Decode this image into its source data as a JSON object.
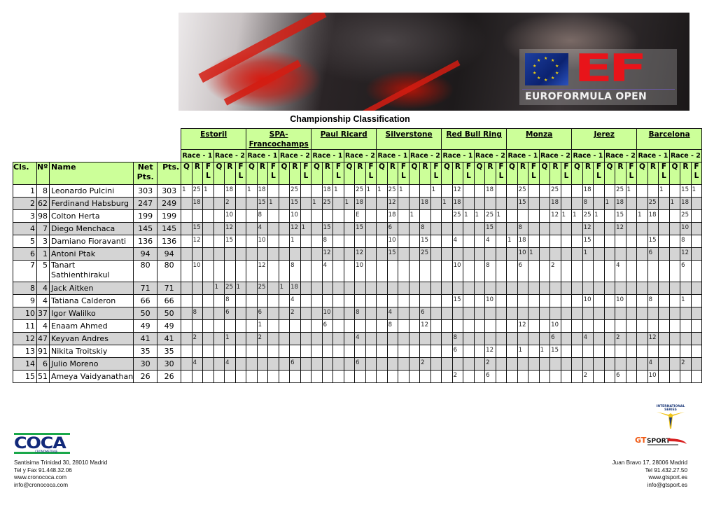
{
  "banner": {
    "logo_text": "EF",
    "logo_subtitle": "EUROFORMULA OPEN"
  },
  "title": "Championship Classification",
  "table": {
    "circuits": [
      "Estoril",
      "SPA-Francochamps",
      "Paul Ricard",
      "Silverstone",
      "Red Bull Ring",
      "Monza",
      "Jerez",
      "Barcelona"
    ],
    "races": [
      "Race - 1",
      "Race - 2"
    ],
    "sub_columns": [
      "Q",
      "R",
      "FL"
    ],
    "headers": {
      "cls": "Cls.",
      "num": "Nº",
      "name": "Name",
      "net": "Net Pts.",
      "pts": "Pts."
    },
    "rows": [
      {
        "cls": "1",
        "num": "8",
        "name": "Leonardo Pulcini",
        "net": "303",
        "pts": "303",
        "cells": [
          "1",
          "25",
          "1",
          "",
          "18",
          "",
          "1",
          "18",
          "",
          "",
          "25",
          "",
          "",
          "18",
          "1",
          "",
          "25",
          "1",
          "1",
          "25",
          "1",
          "",
          "",
          "1",
          "",
          "12",
          "",
          "",
          "18",
          "",
          "",
          "25",
          "",
          "",
          "25",
          "",
          "",
          "18",
          "",
          "",
          "25",
          "1",
          "",
          "",
          "1",
          "",
          "15",
          "1"
        ]
      },
      {
        "cls": "2",
        "num": "62",
        "name": "Ferdinand Habsburg",
        "net": "247",
        "pts": "249",
        "cells": [
          "",
          "18",
          "",
          "",
          "2",
          "",
          "",
          "15",
          "1",
          "",
          "15",
          "",
          "1",
          "25",
          "",
          "1",
          "18",
          "",
          "",
          "12",
          "",
          "",
          "18",
          "",
          "1",
          "18",
          "",
          "",
          "",
          "",
          "",
          "15",
          "",
          "",
          "18",
          "",
          "",
          "8",
          "",
          "1",
          "18",
          "",
          "",
          "25",
          "",
          "1",
          "18",
          ""
        ]
      },
      {
        "cls": "3",
        "num": "98",
        "name": "Colton Herta",
        "net": "199",
        "pts": "199",
        "cells": [
          "",
          "",
          "",
          "",
          "10",
          "",
          "",
          "8",
          "",
          "",
          "10",
          "",
          "",
          "",
          "",
          "",
          "E",
          "",
          "",
          "18",
          "",
          "1",
          "",
          "",
          "",
          "25",
          "1",
          "1",
          "25",
          "1",
          "",
          "",
          "",
          "",
          "12",
          "1",
          "1",
          "25",
          "1",
          "",
          "15",
          "",
          "1",
          "18",
          "",
          "",
          "25",
          ""
        ]
      },
      {
        "cls": "4",
        "num": "7",
        "name": "Diego Menchaca",
        "net": "145",
        "pts": "145",
        "cells": [
          "",
          "15",
          "",
          "",
          "12",
          "",
          "",
          "4",
          "",
          "",
          "12",
          "1",
          "",
          "15",
          "",
          "",
          "15",
          "",
          "",
          "6",
          "",
          "",
          "8",
          "",
          "",
          "",
          "",
          "",
          "15",
          "",
          "",
          "8",
          "",
          "",
          "",
          "",
          "",
          "12",
          "",
          "",
          "12",
          "",
          "",
          "",
          "",
          "",
          "10",
          ""
        ]
      },
      {
        "cls": "5",
        "num": "3",
        "name": "Damiano Fioravanti",
        "net": "136",
        "pts": "136",
        "cells": [
          "",
          "12",
          "",
          "",
          "15",
          "",
          "",
          "10",
          "",
          "",
          "1",
          "",
          "",
          "8",
          "",
          "",
          "",
          "",
          "",
          "10",
          "",
          "",
          "15",
          "",
          "",
          "4",
          "",
          "",
          "4",
          "",
          "1",
          "18",
          "",
          "",
          "",
          "",
          "",
          "15",
          "",
          "",
          "",
          "",
          "",
          "15",
          "",
          "",
          "8",
          ""
        ]
      },
      {
        "cls": "6",
        "num": "1",
        "name": "Antoni Ptak",
        "net": "94",
        "pts": "94",
        "cells": [
          "",
          "",
          "",
          "",
          "",
          "",
          "",
          "",
          "",
          "",
          "",
          "",
          "",
          "12",
          "",
          "",
          "12",
          "",
          "",
          "15",
          "",
          "",
          "25",
          "",
          "",
          "",
          "",
          "",
          "",
          "",
          "",
          "10",
          "1",
          "",
          "",
          "",
          "",
          "1",
          "",
          "",
          "",
          "",
          "",
          "6",
          "",
          "",
          "12",
          ""
        ]
      },
      {
        "cls": "7",
        "num": "5",
        "name": "Tanart Sathienthirakul",
        "net": "80",
        "pts": "80",
        "cells": [
          "",
          "10",
          "",
          "",
          "",
          "",
          "",
          "12",
          "",
          "",
          "8",
          "",
          "",
          "4",
          "",
          "",
          "10",
          "",
          "",
          "",
          "",
          "",
          "",
          "",
          "",
          "10",
          "",
          "",
          "8",
          "",
          "",
          "6",
          "",
          "",
          "2",
          "",
          "",
          "",
          "",
          "",
          "4",
          "",
          "",
          "",
          "",
          "",
          "6",
          ""
        ]
      },
      {
        "cls": "8",
        "num": "4",
        "name": "Jack Aitken",
        "net": "71",
        "pts": "71",
        "cells": [
          "",
          "",
          "",
          "1",
          "25",
          "1",
          "",
          "25",
          "",
          "1",
          "18",
          "",
          "",
          "",
          "",
          "",
          "",
          "",
          "",
          "",
          "",
          "",
          "",
          "",
          "",
          "",
          "",
          "",
          "",
          "",
          "",
          "",
          "",
          "",
          "",
          "",
          "",
          "",
          "",
          "",
          "",
          "",
          "",
          "",
          "",
          "",
          "",
          ""
        ]
      },
      {
        "cls": "9",
        "num": "4",
        "name": "Tatiana Calderon",
        "net": "66",
        "pts": "66",
        "cells": [
          "",
          "",
          "",
          "",
          "8",
          "",
          "",
          "",
          "",
          "",
          "4",
          "",
          "",
          "",
          "",
          "",
          "",
          "",
          "",
          "",
          "",
          "",
          "",
          "",
          "",
          "15",
          "",
          "",
          "10",
          "",
          "",
          "",
          "",
          "",
          "",
          "",
          "",
          "10",
          "",
          "",
          "10",
          "",
          "",
          "8",
          "",
          "",
          "1",
          ""
        ]
      },
      {
        "cls": "10",
        "num": "37",
        "name": "Igor Walilko",
        "net": "50",
        "pts": "50",
        "cells": [
          "",
          "8",
          "",
          "",
          "6",
          "",
          "",
          "6",
          "",
          "",
          "2",
          "",
          "",
          "10",
          "",
          "",
          "8",
          "",
          "",
          "4",
          "",
          "",
          "6",
          "",
          "",
          "",
          "",
          "",
          "",
          "",
          "",
          "",
          "",
          "",
          "",
          "",
          "",
          "",
          "",
          "",
          "",
          "",
          "",
          "",
          "",
          "",
          "",
          ""
        ]
      },
      {
        "cls": "11",
        "num": "4",
        "name": "Enaam Ahmed",
        "net": "49",
        "pts": "49",
        "cells": [
          "",
          "",
          "",
          "",
          "",
          "",
          "",
          "1",
          "",
          "",
          "",
          "",
          "",
          "6",
          "",
          "",
          "",
          "",
          "",
          "8",
          "",
          "",
          "12",
          "",
          "",
          "",
          "",
          "",
          "",
          "",
          "",
          "12",
          "",
          "",
          "10",
          "",
          "",
          "",
          "",
          "",
          "",
          "",
          "",
          "",
          "",
          "",
          "",
          ""
        ]
      },
      {
        "cls": "12",
        "num": "47",
        "name": "Keyvan Andres",
        "net": "41",
        "pts": "41",
        "cells": [
          "",
          "2",
          "",
          "",
          "1",
          "",
          "",
          "2",
          "",
          "",
          "",
          "",
          "",
          "",
          "",
          "",
          "4",
          "",
          "",
          "",
          "",
          "",
          "",
          "",
          "",
          "8",
          "",
          "",
          "",
          "",
          "",
          "",
          "",
          "",
          "6",
          "",
          "",
          "4",
          "",
          "",
          "2",
          "",
          "",
          "12",
          "",
          "",
          "",
          ""
        ]
      },
      {
        "cls": "13",
        "num": "91",
        "name": "Nikita Troitskiy",
        "net": "35",
        "pts": "35",
        "cells": [
          "",
          "",
          "",
          "",
          "",
          "",
          "",
          "",
          "",
          "",
          "",
          "",
          "",
          "",
          "",
          "",
          "",
          "",
          "",
          "",
          "",
          "",
          "",
          "",
          "",
          "6",
          "",
          "",
          "12",
          "",
          "",
          "1",
          "",
          "1",
          "15",
          "",
          "",
          "",
          "",
          "",
          "",
          "",
          "",
          "",
          "",
          "",
          "",
          ""
        ]
      },
      {
        "cls": "14",
        "num": "6",
        "name": "Julio Moreno",
        "net": "30",
        "pts": "30",
        "cells": [
          "",
          "4",
          "",
          "",
          "4",
          "",
          "",
          "",
          "",
          "",
          "6",
          "",
          "",
          "",
          "",
          "",
          "6",
          "",
          "",
          "",
          "",
          "",
          "2",
          "",
          "",
          "",
          "",
          "",
          "2",
          "",
          "",
          "",
          "",
          "",
          "",
          "",
          "",
          "",
          "",
          "",
          "",
          "",
          "",
          "4",
          "",
          "",
          "2",
          ""
        ]
      },
      {
        "cls": "15",
        "num": "51",
        "name": "Ameya Vaidyanathan",
        "net": "26",
        "pts": "26",
        "cells": [
          "",
          "",
          "",
          "",
          "",
          "",
          "",
          "",
          "",
          "",
          "",
          "",
          "",
          "",
          "",
          "",
          "",
          "",
          "",
          "",
          "",
          "",
          "",
          "",
          "",
          "2",
          "",
          "",
          "6",
          "",
          "",
          "",
          "",
          "",
          "",
          "",
          "",
          "2",
          "",
          "",
          "6",
          "",
          "",
          "10",
          "",
          "",
          "",
          ""
        ]
      }
    ]
  },
  "footer_left": {
    "logo_text": "COCA",
    "logo_subtitle": "CRONOMETRAJE",
    "lines": [
      "Santisima Trinidad 30, 28010 Madrid",
      "Tel y Fax 91.448.32.06",
      "www.cronococa.com",
      "info@cronococa.com"
    ]
  },
  "footer_right": {
    "badge_text": "INTERNATIONAL SERIES",
    "logo_text": "GTSPORT",
    "lines": [
      "Juan Bravo 17, 28006 Madrid",
      "Tel 91.432.27.50",
      "www.gtsport.es",
      "info@gtsport.es"
    ]
  },
  "colors": {
    "header_green": "#ccff99",
    "row_gray": "#d4d4d4",
    "ef_red": "#e8141a",
    "coca_blue": "#12297a",
    "coca_green": "#1aa84a",
    "gt_orange": "#f05a14"
  }
}
